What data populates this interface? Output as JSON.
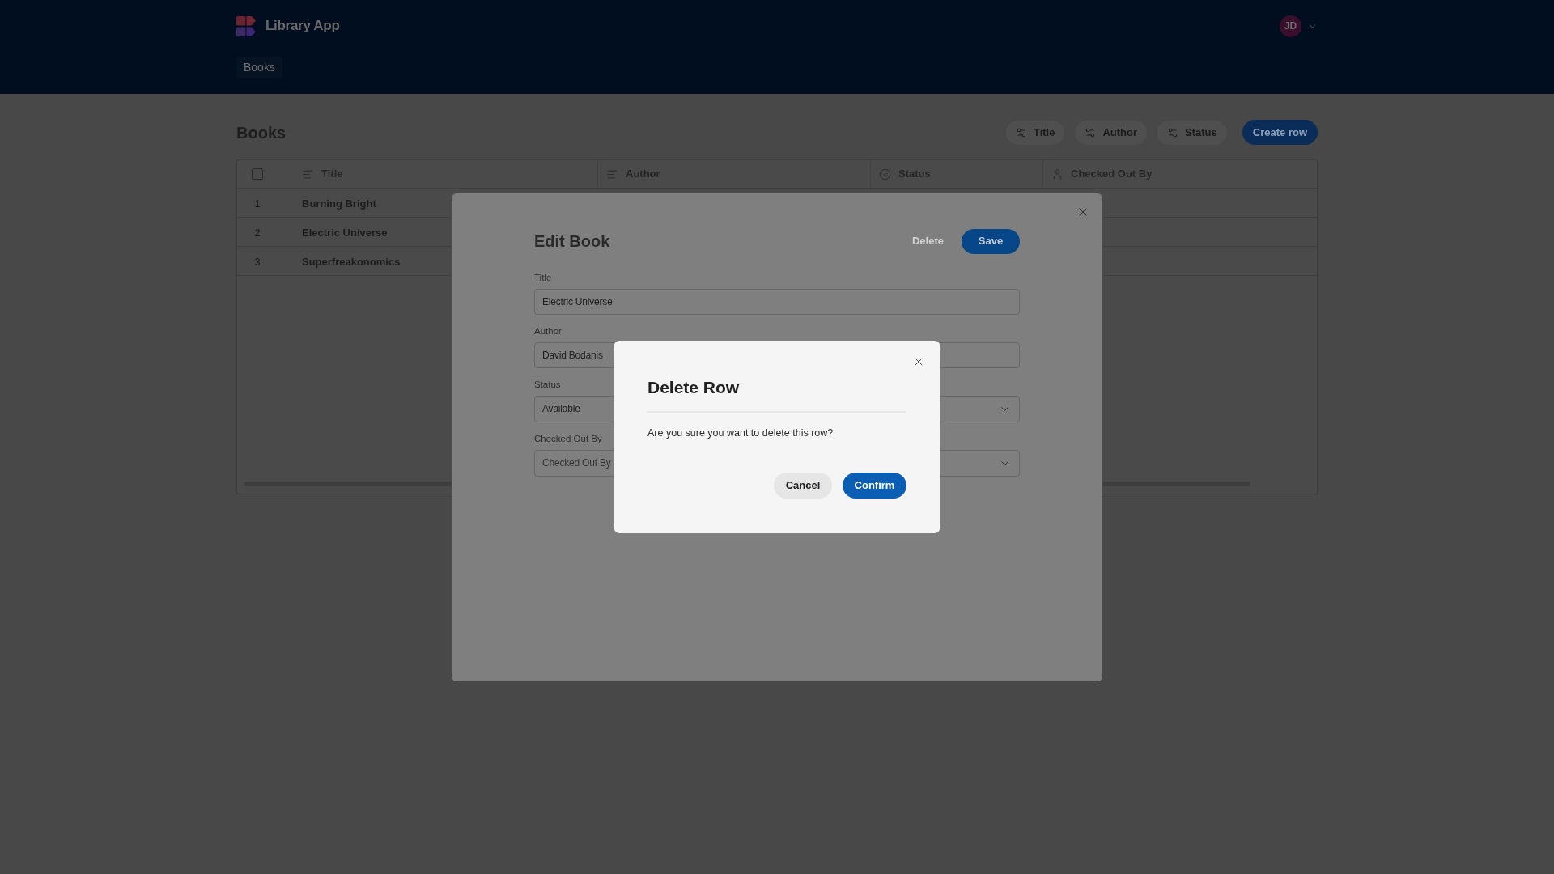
{
  "header": {
    "app_name": "Library App",
    "nav": [
      {
        "label": "Books",
        "selected": true
      }
    ],
    "user": {
      "initials": "JD"
    }
  },
  "page": {
    "title": "Books",
    "filters": [
      {
        "label": "Title"
      },
      {
        "label": "Author"
      },
      {
        "label": "Status"
      }
    ],
    "create_button": "Create row"
  },
  "table": {
    "select_all": {
      "checked": false
    },
    "columns": [
      {
        "label": "Title",
        "kind": "text"
      },
      {
        "label": "Author",
        "kind": "text"
      },
      {
        "label": "Status",
        "kind": "status"
      },
      {
        "label": "Checked Out By",
        "kind": "user"
      }
    ],
    "rows": [
      {
        "number": "1",
        "title": "Burning Bright"
      },
      {
        "number": "2",
        "title": "Electric Universe"
      },
      {
        "number": "3",
        "title": "Superfreakonomics"
      }
    ]
  },
  "edit_dialog": {
    "title": "Edit Book",
    "delete_button": "Delete",
    "save_button": "Save",
    "fields": [
      {
        "label": "Title",
        "kind": "input",
        "value": "Electric Universe"
      },
      {
        "label": "Author",
        "kind": "input",
        "value": "David Bodanis"
      },
      {
        "label": "Status",
        "kind": "select",
        "value": "Available"
      },
      {
        "label": "Checked Out By",
        "kind": "select",
        "placeholder": "Checked Out By"
      }
    ]
  },
  "delete_dialog": {
    "title": "Delete Row",
    "message": "Are you sure you want to delete this row?",
    "cancel_button": "Cancel",
    "confirm_button": "Confirm"
  }
}
